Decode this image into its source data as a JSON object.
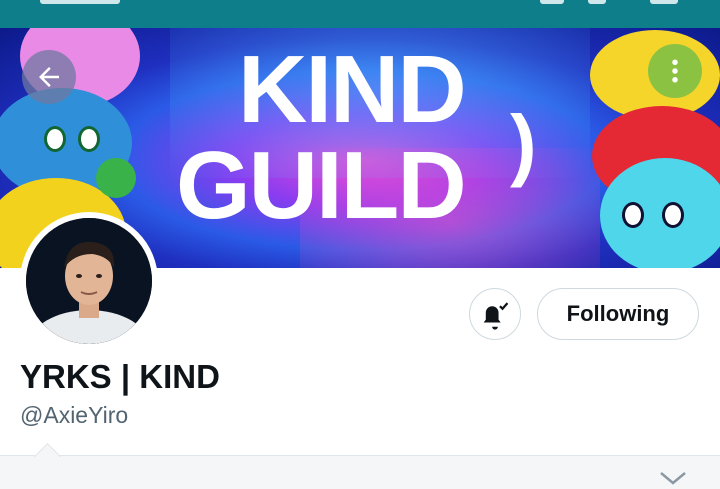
{
  "banner": {
    "line1": "KIND",
    "line2": "GUILD",
    "paren": ")"
  },
  "profile": {
    "display_name": "YRKS | KIND",
    "handle": "@AxieYiro"
  },
  "actions": {
    "following_label": "Following"
  },
  "icons": {
    "back": "arrow-left-icon",
    "more": "more-vertical-icon",
    "notifications": "bell-check-icon",
    "expand": "chevron-down-icon"
  },
  "colors": {
    "status_bar": "#0e7f8a",
    "text_primary": "#0f1419",
    "text_secondary": "#536471",
    "button_border": "#cfd9de"
  }
}
